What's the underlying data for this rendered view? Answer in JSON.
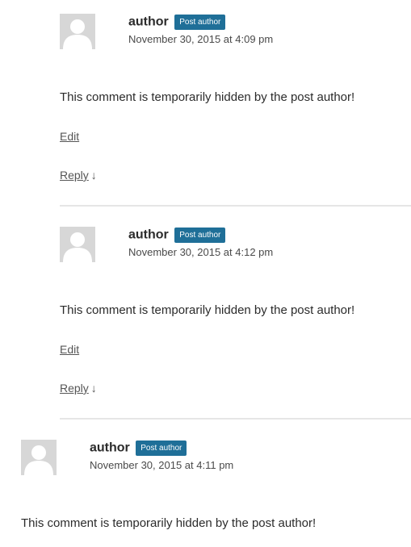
{
  "comments": [
    {
      "author": "author",
      "badge": "Post author",
      "date": "November 30, 2015 at 4:09 pm",
      "text": "This comment is temporarily hidden by the post author!",
      "edit": "Edit",
      "reply": "Reply",
      "reply_arrow": "↓"
    },
    {
      "author": "author",
      "badge": "Post author",
      "date": "November 30, 2015 at 4:12 pm",
      "text": "This comment is temporarily hidden by the post author!",
      "edit": "Edit",
      "reply": "Reply",
      "reply_arrow": "↓"
    },
    {
      "author": "author",
      "badge": "Post author",
      "date": "November 30, 2015 at 4:11 pm",
      "text": "This comment is temporarily hidden by the post author!"
    }
  ],
  "icons": {
    "avatar": "default-avatar-icon"
  },
  "colors": {
    "badge_bg": "#1f6f98",
    "avatar_bg": "#d7d7d7"
  }
}
